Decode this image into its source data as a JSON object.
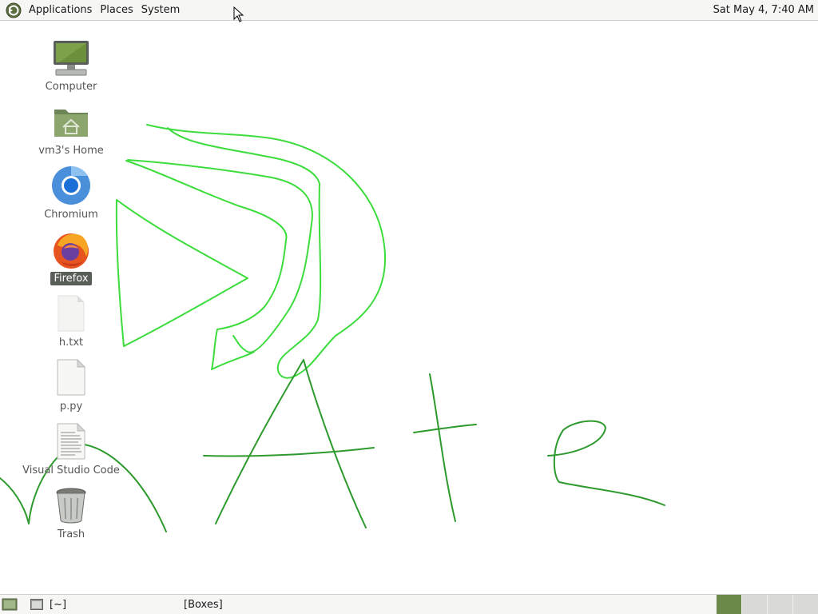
{
  "top_panel": {
    "menus": [
      "Applications",
      "Places",
      "System"
    ],
    "clock": "Sat May  4,  7:40 AM",
    "logo_icon": "mate-logo-icon"
  },
  "desktop": {
    "icons": [
      {
        "label": "Computer",
        "icon": "computer-icon",
        "selected": false
      },
      {
        "label": "vm3's Home",
        "icon": "home-folder-icon",
        "selected": false
      },
      {
        "label": "Chromium",
        "icon": "chromium-icon",
        "selected": false
      },
      {
        "label": "Firefox",
        "icon": "firefox-icon",
        "selected": true
      },
      {
        "label": "h.txt",
        "icon": "text-file-icon",
        "selected": false
      },
      {
        "label": "p.py",
        "icon": "python-file-icon",
        "selected": false
      },
      {
        "label": "Visual Studio Code",
        "icon": "document-icon",
        "selected": false
      },
      {
        "label": "Trash",
        "icon": "trash-icon",
        "selected": false
      }
    ],
    "drawing_colors": {
      "bright": "#3ddc3d",
      "dark": "#2e9a2e"
    }
  },
  "bottom_panel": {
    "tasks": [
      {
        "label": "[~]",
        "icon": "terminal-icon"
      },
      {
        "label": "[Boxes]",
        "icon": "window-icon"
      }
    ],
    "workspace_count": 4,
    "active_workspace": 1
  }
}
